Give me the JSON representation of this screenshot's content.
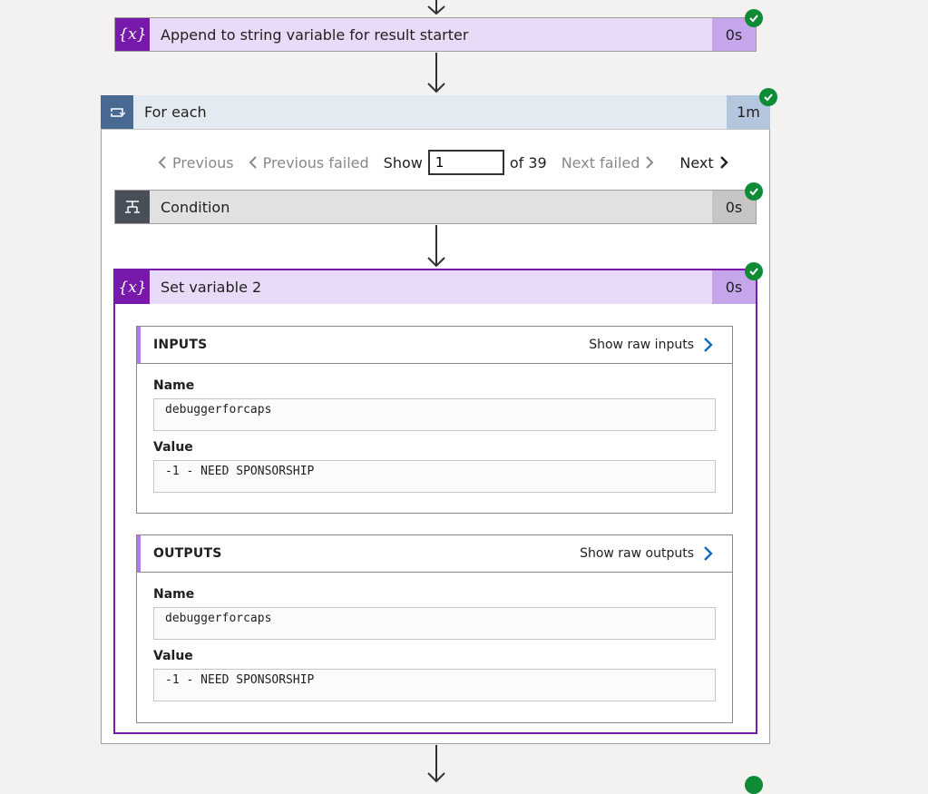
{
  "append_action": {
    "icon": "variable-icon",
    "icon_glyph": "{x}",
    "title": "Append to string variable for result starter",
    "duration": "0s",
    "status": "succeeded"
  },
  "foreach": {
    "icon": "loop-icon",
    "title": "For each",
    "duration": "1m",
    "status": "succeeded"
  },
  "pager": {
    "previous": "Previous",
    "previous_failed": "Previous failed",
    "show": "Show",
    "current": "1",
    "of_total": "of 39",
    "next_failed": "Next failed",
    "next": "Next"
  },
  "condition": {
    "icon": "condition-icon",
    "title": "Condition",
    "duration": "0s",
    "status": "succeeded"
  },
  "set_variable": {
    "icon_glyph": "{x}",
    "title": "Set variable 2",
    "duration": "0s",
    "status": "succeeded",
    "inputs": {
      "heading": "INPUTS",
      "raw_link": "Show raw inputs",
      "name_label": "Name",
      "name_value": "debuggerforcaps",
      "value_label": "Value",
      "value_value": "-1 - NEED SPONSORSHIP"
    },
    "outputs": {
      "heading": "OUTPUTS",
      "raw_link": "Show raw outputs",
      "name_label": "Name",
      "name_value": "debuggerforcaps",
      "value_label": "Value",
      "value_value": "-1 - NEED SPONSORSHIP"
    }
  },
  "colors": {
    "variable_accent": "#7719aa",
    "variable_header": "#e9dbf7",
    "foreach_accent": "#486991",
    "condition_accent": "#484f58",
    "success": "#0f8a35",
    "link_chevron": "#0f6cbd"
  }
}
